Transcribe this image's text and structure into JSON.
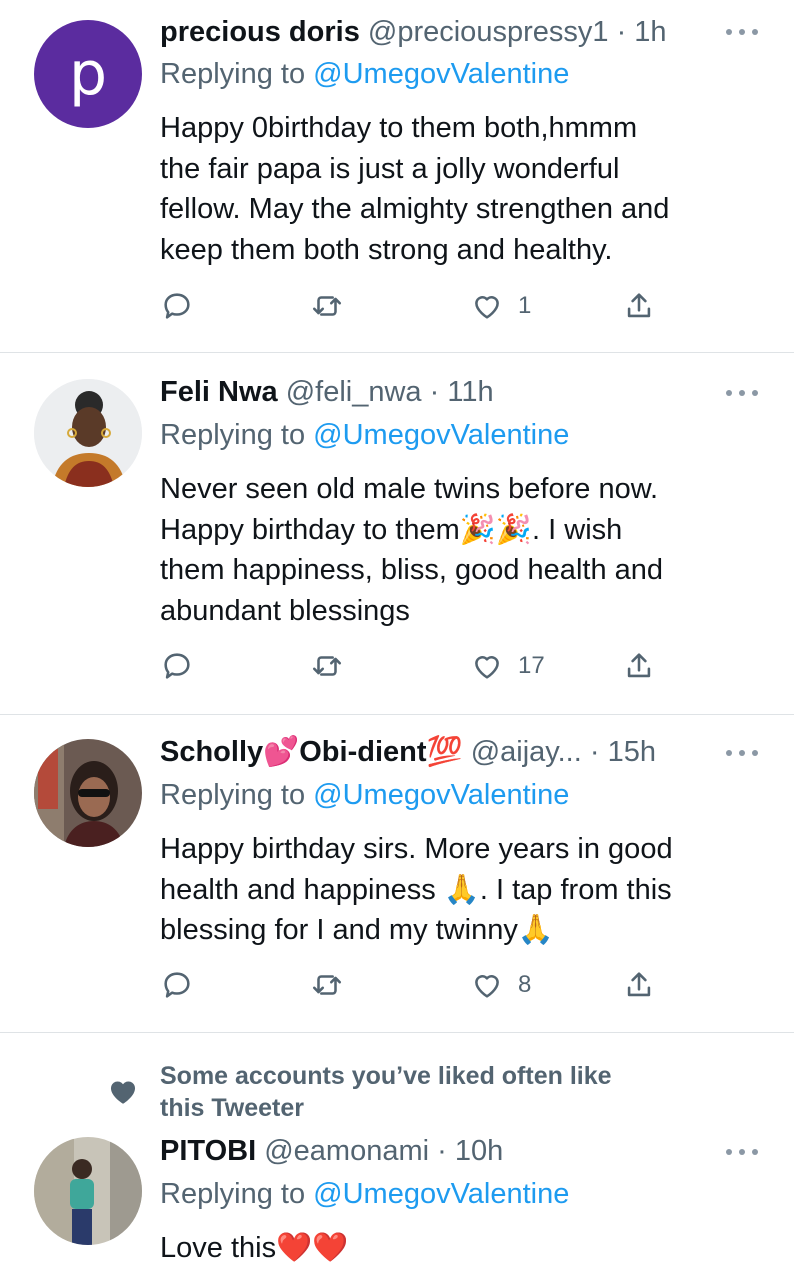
{
  "tweets": [
    {
      "name": "precious doris",
      "handle": "@preciouspressy1",
      "dot": "·",
      "time": "1h",
      "avatar_letter": "p",
      "replying_prefix": "Replying to",
      "replying_to": "@UmegovValentine",
      "lines": [
        "Happy 0birthday to them both,hmmm",
        "the fair papa is just a jolly wonderful",
        "fellow. May the almighty strengthen and",
        "keep them both strong and healthy."
      ],
      "likes": "1"
    },
    {
      "name": "Feli Nwa",
      "handle": "@feli_nwa",
      "dot": "·",
      "time": "11h",
      "replying_prefix": "Replying to",
      "replying_to": "@UmegovValentine",
      "lines": [
        "Never seen old male twins before now.",
        "Happy birthday to them🎉🎉. I wish",
        "them happiness, bliss, good health and",
        "abundant blessings"
      ],
      "likes": "17"
    },
    {
      "name": "Scholly💕Obi-dient💯",
      "handle": "@aijay...",
      "dot": "·",
      "time": "15h",
      "replying_prefix": "Replying to",
      "replying_to": "@UmegovValentine",
      "lines": [
        "Happy birthday sirs. More years in good",
        "health and happiness 🙏. I tap from this",
        "blessing for I and my twinny🙏"
      ],
      "likes": "8"
    },
    {
      "social_context": [
        "Some accounts you’ve liked often like",
        "this Tweeter"
      ],
      "name": "PITOBI",
      "handle": "@eamonami",
      "dot": "·",
      "time": "10h",
      "replying_prefix": "Replying to",
      "replying_to": "@UmegovValentine",
      "lines": [
        "Love this❤️❤️"
      ]
    }
  ],
  "icons": {
    "reply": "reply-icon",
    "retweet": "retweet-icon",
    "like": "heart-icon",
    "share": "share-icon",
    "more": "more-icon"
  },
  "colors": {
    "link": "#1d9bf0",
    "secondary_text": "#536471",
    "avatar_purple": "#5b2c9f",
    "divider": "#dfe3e6"
  }
}
